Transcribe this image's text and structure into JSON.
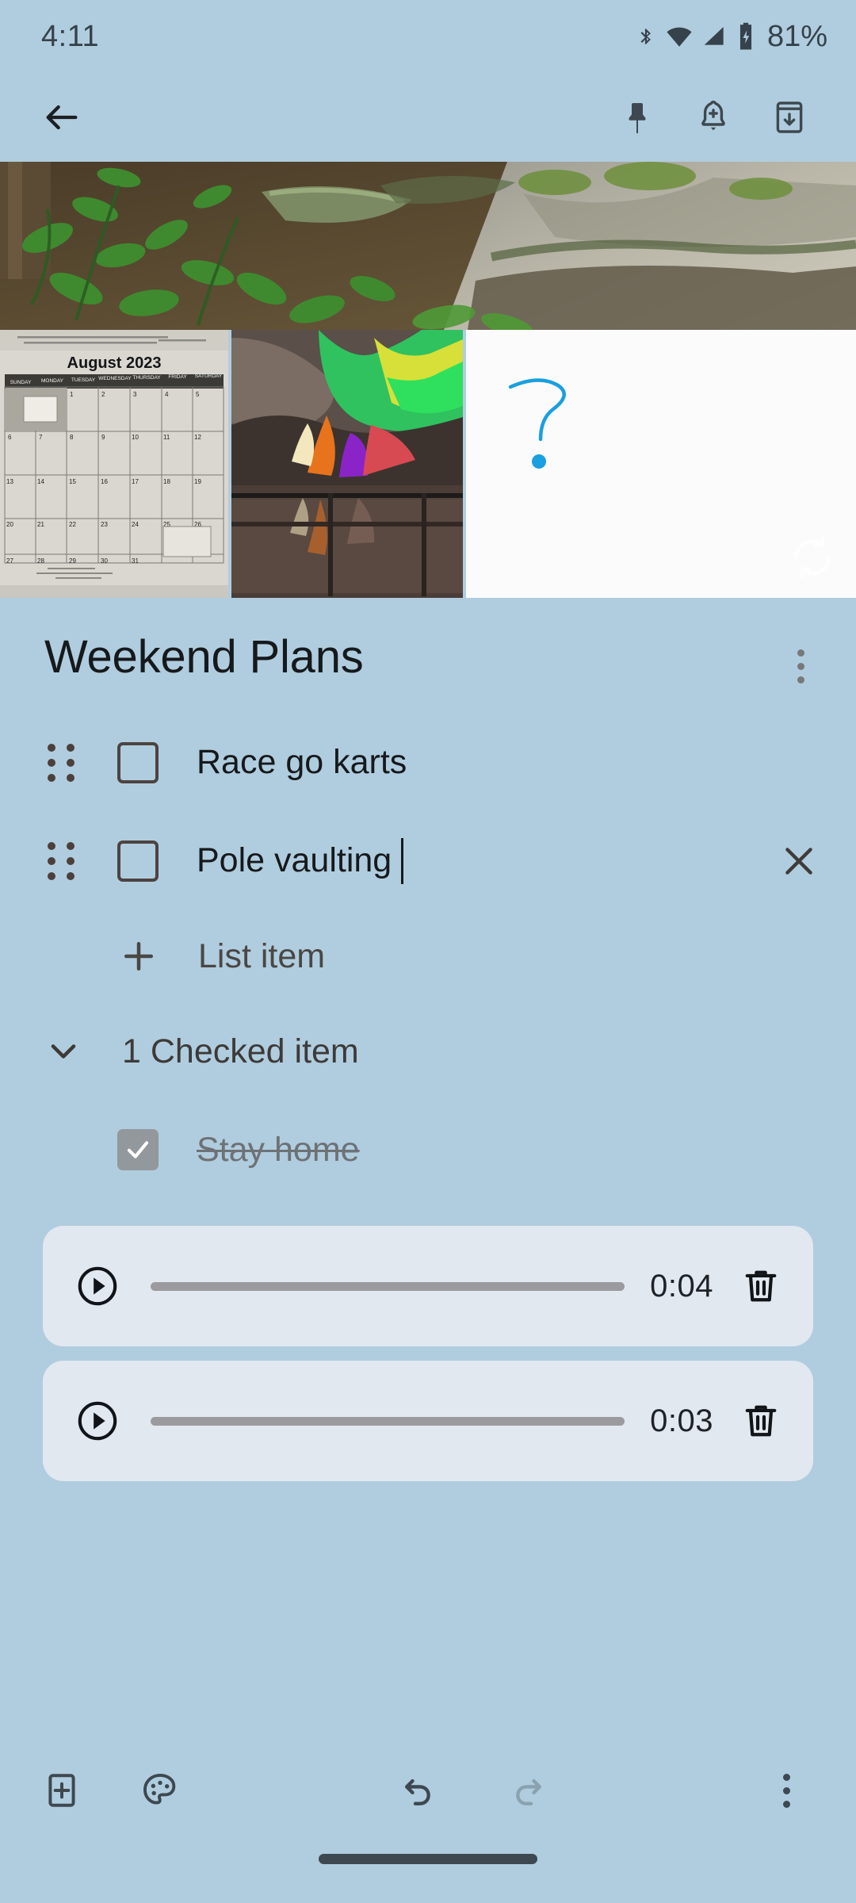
{
  "theme": {
    "background": "#b0cddf",
    "card": "#e1e8f0",
    "text_primary": "#16191c",
    "text_secondary": "#4a4744",
    "icon": "#3d4850",
    "checked_box": "#92989c",
    "progress": "#9a9a9f"
  },
  "status_bar": {
    "time": "4:11",
    "battery_percent": "81%",
    "icons": [
      "bluetooth-icon",
      "wifi-icon",
      "cellular-signal-icon",
      "battery-charging-icon"
    ]
  },
  "app_bar": {
    "back_label": "back-arrow-icon",
    "actions": [
      {
        "name": "pin-note-button",
        "icon": "pin-icon"
      },
      {
        "name": "add-reminder-button",
        "icon": "bell-plus-icon"
      },
      {
        "name": "archive-button",
        "icon": "archive-down-icon"
      }
    ]
  },
  "media": {
    "hero": {
      "name": "note-hero-image",
      "description": "forest floor photo with green plants, moss and a rock ledge"
    },
    "thumbnails": [
      {
        "name": "attachment-calendar-photo",
        "description": "photo of an August 2023 wall calendar",
        "caption": "August 2023"
      },
      {
        "name": "attachment-cave-photo",
        "description": "photo of a colorfully lit cave with water reflection"
      },
      {
        "name": "attachment-drawing",
        "description": "white drawing canvas with a blue hand drawn question mark",
        "sync_icon": "sync-icon"
      }
    ]
  },
  "note": {
    "title": "Weekend Plans",
    "overflow_menu": "note-overflow-menu",
    "items": [
      {
        "text": "Race go karts",
        "checked": false,
        "focused": false
      },
      {
        "text": "Pole vaulting",
        "checked": false,
        "focused": true
      }
    ],
    "add_item_label": "List item",
    "checked_section": {
      "label": "1 Checked item",
      "expanded": true,
      "items": [
        {
          "text": "Stay home",
          "checked": true
        }
      ]
    },
    "audio_recordings": [
      {
        "duration": "0:04",
        "play_label": "play-recording-button",
        "delete_label": "delete-recording-button"
      },
      {
        "duration": "0:03",
        "play_label": "play-recording-button",
        "delete_label": "delete-recording-button"
      }
    ]
  },
  "bottom_bar": {
    "actions": [
      {
        "name": "add-attachment-button",
        "icon": "add-box-icon",
        "enabled": true
      },
      {
        "name": "background-options-button",
        "icon": "palette-icon",
        "enabled": true
      },
      {
        "name": "undo-button",
        "icon": "undo-icon",
        "enabled": true
      },
      {
        "name": "redo-button",
        "icon": "redo-icon",
        "enabled": false
      },
      {
        "name": "more-options-button",
        "icon": "more-vert-icon",
        "enabled": true
      }
    ]
  }
}
